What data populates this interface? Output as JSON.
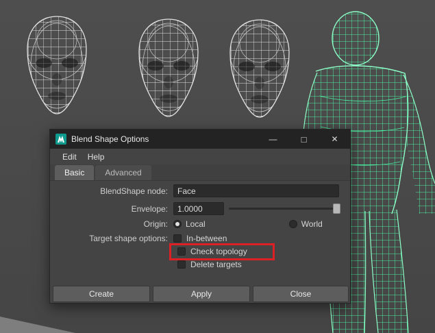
{
  "colors": {
    "highlight_red": "#dd2025",
    "wireframe_white": "#e2e2e2",
    "wireframe_green": "#4aeea0",
    "wireframe_green_bright": "#8effc8",
    "dialog_bg": "#444444",
    "titlebar_bg": "#232323"
  },
  "window": {
    "title": "Blend Shape Options",
    "controls": {
      "minimize": "—",
      "maximize": "□",
      "close": "✕"
    },
    "menu": [
      {
        "label": "Edit"
      },
      {
        "label": "Help"
      }
    ],
    "tabs": [
      {
        "label": "Basic",
        "active": true
      },
      {
        "label": "Advanced",
        "active": false
      }
    ],
    "form": {
      "blendshape_node": {
        "label": "BlendShape node:",
        "value": "Face"
      },
      "envelope": {
        "label": "Envelope:",
        "value": "1.0000",
        "slider_position": 1.0
      },
      "origin": {
        "label": "Origin:",
        "options": [
          {
            "label": "Local",
            "selected": true
          },
          {
            "label": "World",
            "selected": false
          }
        ]
      },
      "target_shape_options": {
        "label": "Target shape options:",
        "items": [
          {
            "label": "In-between",
            "checked": false,
            "highlighted": false
          },
          {
            "label": "Check topology",
            "checked": false,
            "highlighted": true
          },
          {
            "label": "Delete targets",
            "checked": false,
            "highlighted": false
          }
        ]
      }
    },
    "buttons": [
      {
        "label": "Create"
      },
      {
        "label": "Apply"
      },
      {
        "label": "Close"
      }
    ]
  }
}
